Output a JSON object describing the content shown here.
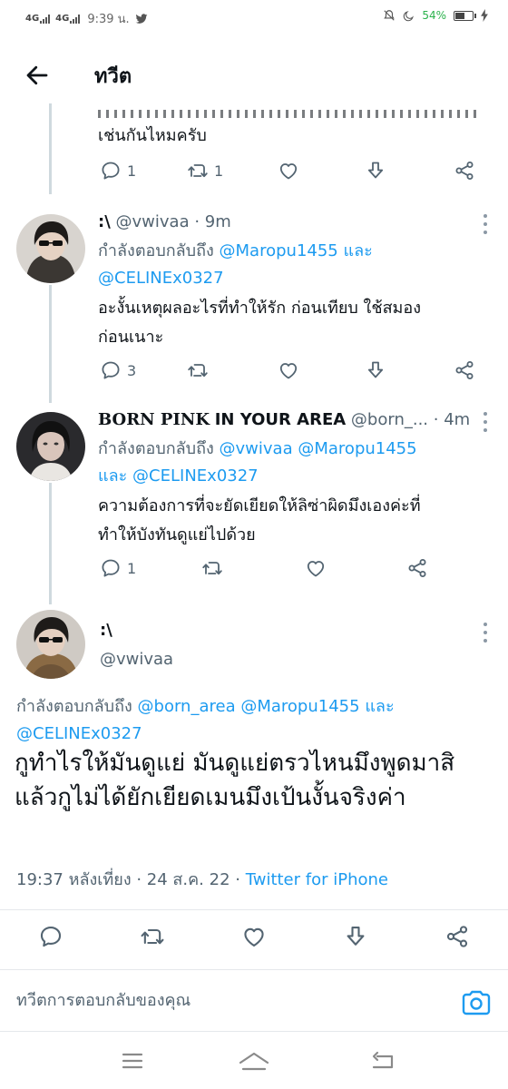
{
  "status_bar": {
    "net1": "4G",
    "net2": "4G",
    "time": "9:39 น.",
    "battery": "54%"
  },
  "header": {
    "title": "ทวีต"
  },
  "tweet0": {
    "text_line": "เช่นกันไหมครับ",
    "reply_count": "1",
    "retweet_count": "1"
  },
  "tweet1": {
    "name": ":\\",
    "handle_time": "@vwivaa · 9m",
    "reply_prefix": "กำลังตอบกลับถึง",
    "mention1": "@Maropu1455",
    "joiner": "และ",
    "mention2": "@CELINEx0327",
    "body_line1": "อะงั้นเหตุผลอะไรที่ทำให้รัก ก่อนเทียบ ใช้สมอง",
    "body_line2": "ก่อนเนาะ",
    "reply_count": "3"
  },
  "tweet2": {
    "name_part1": "BORN PINK",
    "name_part2": "IN YOUR AREA",
    "handle": "@born_...",
    "time": "· 4m",
    "reply_prefix": "กำลังตอบกลับถึง",
    "mention1": "@vwivaa",
    "mention2": "@Maropu1455",
    "joiner": "และ",
    "mention3": "@CELINEx0327",
    "body_line1": "ความต้องการที่จะยัดเยียดให้ลิซ่าผิดมึงเองค่ะที่",
    "body_line2": "ทำให้บังทันดูแย่ไปด้วย",
    "reply_count": "1"
  },
  "main_tweet": {
    "name": ":\\",
    "handle": "@vwivaa",
    "reply_prefix": "กำลังตอบกลับถึง",
    "mention1": "@born_area",
    "mention2": "@Maropu1455",
    "joiner": "และ",
    "mention3": "@CELINEx0327",
    "body": "กูทำไรให้มันดูแย่ มันดูแย่ตรวไหนมึงพูดมาสิ แล้วกูไม่ได้ยักเยียดเมนมึงเป้นงั้นจริงค่า",
    "time": "19:37 หลังเที่ยง · 24 ส.ค. 22 ·",
    "source": "Twitter for iPhone"
  },
  "compose": {
    "placeholder": "ทวีตการตอบกลับของคุณ"
  },
  "colors": {
    "accent": "#1d9bf0",
    "muted": "#536471",
    "text": "#0f1419"
  },
  "icons": [
    "back-arrow-icon",
    "reply-icon",
    "retweet-icon",
    "like-icon",
    "download-icon",
    "share-icon",
    "camera-icon",
    "menu-icon",
    "home-icon",
    "back-nav-icon",
    "more-icon"
  ]
}
